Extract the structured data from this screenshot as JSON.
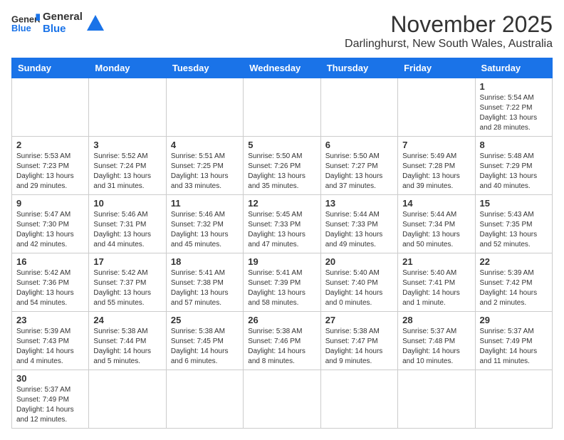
{
  "header": {
    "logo_general": "General",
    "logo_blue": "Blue",
    "month": "November 2025",
    "location": "Darlinghurst, New South Wales, Australia"
  },
  "weekdays": [
    "Sunday",
    "Monday",
    "Tuesday",
    "Wednesday",
    "Thursday",
    "Friday",
    "Saturday"
  ],
  "weeks": [
    [
      {
        "day": "",
        "empty": true
      },
      {
        "day": "",
        "empty": true
      },
      {
        "day": "",
        "empty": true
      },
      {
        "day": "",
        "empty": true
      },
      {
        "day": "",
        "empty": true
      },
      {
        "day": "",
        "empty": true
      },
      {
        "day": "1",
        "sunrise": "Sunrise: 5:54 AM",
        "sunset": "Sunset: 7:22 PM",
        "daylight": "Daylight: 13 hours and 28 minutes."
      }
    ],
    [
      {
        "day": "2",
        "sunrise": "Sunrise: 5:53 AM",
        "sunset": "Sunset: 7:23 PM",
        "daylight": "Daylight: 13 hours and 29 minutes."
      },
      {
        "day": "3",
        "sunrise": "Sunrise: 5:52 AM",
        "sunset": "Sunset: 7:24 PM",
        "daylight": "Daylight: 13 hours and 31 minutes."
      },
      {
        "day": "4",
        "sunrise": "Sunrise: 5:51 AM",
        "sunset": "Sunset: 7:25 PM",
        "daylight": "Daylight: 13 hours and 33 minutes."
      },
      {
        "day": "5",
        "sunrise": "Sunrise: 5:50 AM",
        "sunset": "Sunset: 7:26 PM",
        "daylight": "Daylight: 13 hours and 35 minutes."
      },
      {
        "day": "6",
        "sunrise": "Sunrise: 5:50 AM",
        "sunset": "Sunset: 7:27 PM",
        "daylight": "Daylight: 13 hours and 37 minutes."
      },
      {
        "day": "7",
        "sunrise": "Sunrise: 5:49 AM",
        "sunset": "Sunset: 7:28 PM",
        "daylight": "Daylight: 13 hours and 39 minutes."
      },
      {
        "day": "8",
        "sunrise": "Sunrise: 5:48 AM",
        "sunset": "Sunset: 7:29 PM",
        "daylight": "Daylight: 13 hours and 40 minutes."
      }
    ],
    [
      {
        "day": "9",
        "sunrise": "Sunrise: 5:47 AM",
        "sunset": "Sunset: 7:30 PM",
        "daylight": "Daylight: 13 hours and 42 minutes."
      },
      {
        "day": "10",
        "sunrise": "Sunrise: 5:46 AM",
        "sunset": "Sunset: 7:31 PM",
        "daylight": "Daylight: 13 hours and 44 minutes."
      },
      {
        "day": "11",
        "sunrise": "Sunrise: 5:46 AM",
        "sunset": "Sunset: 7:32 PM",
        "daylight": "Daylight: 13 hours and 45 minutes."
      },
      {
        "day": "12",
        "sunrise": "Sunrise: 5:45 AM",
        "sunset": "Sunset: 7:33 PM",
        "daylight": "Daylight: 13 hours and 47 minutes."
      },
      {
        "day": "13",
        "sunrise": "Sunrise: 5:44 AM",
        "sunset": "Sunset: 7:33 PM",
        "daylight": "Daylight: 13 hours and 49 minutes."
      },
      {
        "day": "14",
        "sunrise": "Sunrise: 5:44 AM",
        "sunset": "Sunset: 7:34 PM",
        "daylight": "Daylight: 13 hours and 50 minutes."
      },
      {
        "day": "15",
        "sunrise": "Sunrise: 5:43 AM",
        "sunset": "Sunset: 7:35 PM",
        "daylight": "Daylight: 13 hours and 52 minutes."
      }
    ],
    [
      {
        "day": "16",
        "sunrise": "Sunrise: 5:42 AM",
        "sunset": "Sunset: 7:36 PM",
        "daylight": "Daylight: 13 hours and 54 minutes."
      },
      {
        "day": "17",
        "sunrise": "Sunrise: 5:42 AM",
        "sunset": "Sunset: 7:37 PM",
        "daylight": "Daylight: 13 hours and 55 minutes."
      },
      {
        "day": "18",
        "sunrise": "Sunrise: 5:41 AM",
        "sunset": "Sunset: 7:38 PM",
        "daylight": "Daylight: 13 hours and 57 minutes."
      },
      {
        "day": "19",
        "sunrise": "Sunrise: 5:41 AM",
        "sunset": "Sunset: 7:39 PM",
        "daylight": "Daylight: 13 hours and 58 minutes."
      },
      {
        "day": "20",
        "sunrise": "Sunrise: 5:40 AM",
        "sunset": "Sunset: 7:40 PM",
        "daylight": "Daylight: 14 hours and 0 minutes."
      },
      {
        "day": "21",
        "sunrise": "Sunrise: 5:40 AM",
        "sunset": "Sunset: 7:41 PM",
        "daylight": "Daylight: 14 hours and 1 minute."
      },
      {
        "day": "22",
        "sunrise": "Sunrise: 5:39 AM",
        "sunset": "Sunset: 7:42 PM",
        "daylight": "Daylight: 14 hours and 2 minutes."
      }
    ],
    [
      {
        "day": "23",
        "sunrise": "Sunrise: 5:39 AM",
        "sunset": "Sunset: 7:43 PM",
        "daylight": "Daylight: 14 hours and 4 minutes."
      },
      {
        "day": "24",
        "sunrise": "Sunrise: 5:38 AM",
        "sunset": "Sunset: 7:44 PM",
        "daylight": "Daylight: 14 hours and 5 minutes."
      },
      {
        "day": "25",
        "sunrise": "Sunrise: 5:38 AM",
        "sunset": "Sunset: 7:45 PM",
        "daylight": "Daylight: 14 hours and 6 minutes."
      },
      {
        "day": "26",
        "sunrise": "Sunrise: 5:38 AM",
        "sunset": "Sunset: 7:46 PM",
        "daylight": "Daylight: 14 hours and 8 minutes."
      },
      {
        "day": "27",
        "sunrise": "Sunrise: 5:38 AM",
        "sunset": "Sunset: 7:47 PM",
        "daylight": "Daylight: 14 hours and 9 minutes."
      },
      {
        "day": "28",
        "sunrise": "Sunrise: 5:37 AM",
        "sunset": "Sunset: 7:48 PM",
        "daylight": "Daylight: 14 hours and 10 minutes."
      },
      {
        "day": "29",
        "sunrise": "Sunrise: 5:37 AM",
        "sunset": "Sunset: 7:49 PM",
        "daylight": "Daylight: 14 hours and 11 minutes."
      }
    ],
    [
      {
        "day": "30",
        "sunrise": "Sunrise: 5:37 AM",
        "sunset": "Sunset: 7:49 PM",
        "daylight": "Daylight: 14 hours and 12 minutes."
      },
      {
        "day": "",
        "empty": true
      },
      {
        "day": "",
        "empty": true
      },
      {
        "day": "",
        "empty": true
      },
      {
        "day": "",
        "empty": true
      },
      {
        "day": "",
        "empty": true
      },
      {
        "day": "",
        "empty": true
      }
    ]
  ]
}
